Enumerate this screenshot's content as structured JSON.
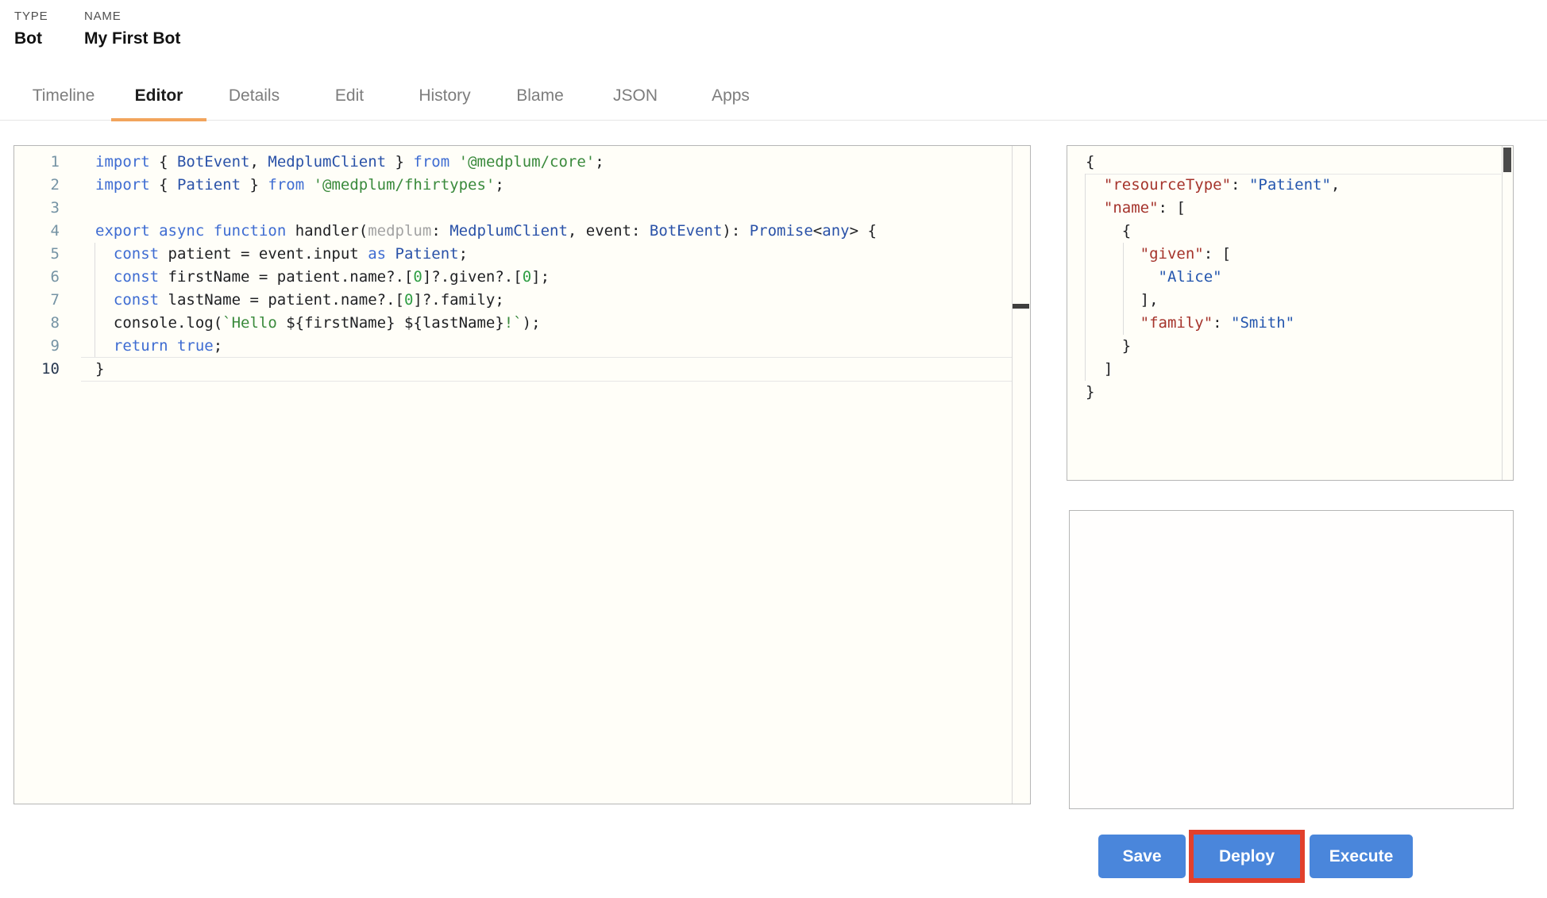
{
  "header": {
    "type_label": "TYPE",
    "type_value": "Bot",
    "name_label": "NAME",
    "name_value": "My First Bot"
  },
  "tabs": {
    "active": "Editor",
    "items": [
      {
        "label": "Timeline"
      },
      {
        "label": "Editor"
      },
      {
        "label": "Details"
      },
      {
        "label": "Edit"
      },
      {
        "label": "History"
      },
      {
        "label": "Blame"
      },
      {
        "label": "JSON"
      },
      {
        "label": "Apps"
      }
    ]
  },
  "colors": {
    "active_tab_underline": "#f2a45c",
    "button_blue": "#4a86db",
    "annotation_red": "#e2402c",
    "keyword_blue": "#3e6cd2",
    "type_blue": "#2a52a8",
    "string_green": "#3a8a3c",
    "json_key_red": "#a5342c",
    "json_value_blue": "#2456ae"
  },
  "code_editor": {
    "active_line": 10,
    "lines": [
      [
        [
          "k",
          "import"
        ],
        [
          "p",
          " { "
        ],
        [
          "t",
          "BotEvent"
        ],
        [
          "p",
          ", "
        ],
        [
          "t",
          "MedplumClient"
        ],
        [
          "p",
          " } "
        ],
        [
          "k",
          "from"
        ],
        [
          "p",
          " "
        ],
        [
          "s",
          "'@medplum/core'"
        ],
        [
          "p",
          ";"
        ]
      ],
      [
        [
          "k",
          "import"
        ],
        [
          "p",
          " { "
        ],
        [
          "t",
          "Patient"
        ],
        [
          "p",
          " } "
        ],
        [
          "k",
          "from"
        ],
        [
          "p",
          " "
        ],
        [
          "s",
          "'@medplum/fhirtypes'"
        ],
        [
          "p",
          ";"
        ]
      ],
      [],
      [
        [
          "k",
          "export"
        ],
        [
          "p",
          " "
        ],
        [
          "k",
          "async"
        ],
        [
          "p",
          " "
        ],
        [
          "k",
          "function"
        ],
        [
          "p",
          " "
        ],
        [
          "p",
          "handler("
        ],
        [
          "g",
          "medplum"
        ],
        [
          "p",
          ": "
        ],
        [
          "t",
          "MedplumClient"
        ],
        [
          "p",
          ", event: "
        ],
        [
          "t",
          "BotEvent"
        ],
        [
          "p",
          "): "
        ],
        [
          "t",
          "Promise"
        ],
        [
          "p",
          "<"
        ],
        [
          "t",
          "any"
        ],
        [
          "p",
          "> {"
        ]
      ],
      [
        [
          "p",
          "  "
        ],
        [
          "k",
          "const"
        ],
        [
          "p",
          " patient = event.input "
        ],
        [
          "k",
          "as"
        ],
        [
          "p",
          " "
        ],
        [
          "t",
          "Patient"
        ],
        [
          "p",
          ";"
        ]
      ],
      [
        [
          "p",
          "  "
        ],
        [
          "k",
          "const"
        ],
        [
          "p",
          " firstName = patient.name?.["
        ],
        [
          "n",
          "0"
        ],
        [
          "p",
          "]?.given?.["
        ],
        [
          "n",
          "0"
        ],
        [
          "p",
          "];"
        ]
      ],
      [
        [
          "p",
          "  "
        ],
        [
          "k",
          "const"
        ],
        [
          "p",
          " lastName = patient.name?.["
        ],
        [
          "n",
          "0"
        ],
        [
          "p",
          "]?.family;"
        ]
      ],
      [
        [
          "p",
          "  console.log("
        ],
        [
          "s",
          "`Hello "
        ],
        [
          "p",
          "${firstName} ${lastName}"
        ],
        [
          "s",
          "!`"
        ],
        [
          "p",
          ");"
        ]
      ],
      [
        [
          "p",
          "  "
        ],
        [
          "k",
          "return"
        ],
        [
          "p",
          " "
        ],
        [
          "k",
          "true"
        ],
        [
          "p",
          ";"
        ]
      ],
      [
        [
          "p",
          "}"
        ]
      ]
    ]
  },
  "input_panel": {
    "active_line": 1,
    "lines": [
      [
        [
          "p",
          "{"
        ]
      ],
      [
        [
          "p",
          "  "
        ],
        [
          "key",
          "\"resourceType\""
        ],
        [
          "p",
          ": "
        ],
        [
          "val",
          "\"Patient\""
        ],
        [
          "p",
          ","
        ]
      ],
      [
        [
          "p",
          "  "
        ],
        [
          "key",
          "\"name\""
        ],
        [
          "p",
          ": ["
        ]
      ],
      [
        [
          "p",
          "    {"
        ]
      ],
      [
        [
          "p",
          "      "
        ],
        [
          "key",
          "\"given\""
        ],
        [
          "p",
          ": ["
        ]
      ],
      [
        [
          "p",
          "        "
        ],
        [
          "val",
          "\"Alice\""
        ]
      ],
      [
        [
          "p",
          "      ],"
        ]
      ],
      [
        [
          "p",
          "      "
        ],
        [
          "key",
          "\"family\""
        ],
        [
          "p",
          ": "
        ],
        [
          "val",
          "\"Smith\""
        ]
      ],
      [
        [
          "p",
          "    }"
        ]
      ],
      [
        [
          "p",
          "  ]"
        ]
      ],
      [
        [
          "p",
          "}"
        ]
      ]
    ]
  },
  "actions": {
    "save_label": "Save",
    "deploy_label": "Deploy",
    "execute_label": "Execute"
  }
}
